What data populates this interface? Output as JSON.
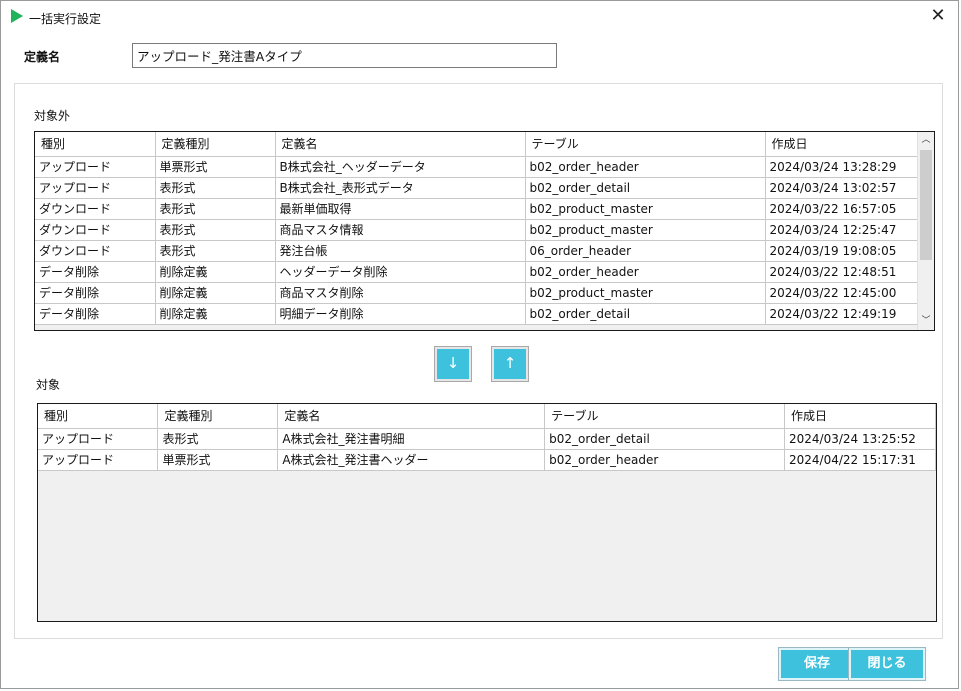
{
  "window": {
    "title": "一括実行設定",
    "close_glyph": "✕"
  },
  "definition": {
    "label": "定義名",
    "value": "アップロード_発注書Aタイプ"
  },
  "excluded": {
    "label": "対象外",
    "columns": [
      "種別",
      "定義種別",
      "定義名",
      "テーブル",
      "作成日"
    ],
    "rows": [
      [
        "アップロード",
        "単票形式",
        "B株式会社_ヘッダーデータ",
        "b02_order_header",
        "2024/03/24 13:28:29"
      ],
      [
        "アップロード",
        "表形式",
        "B株式会社_表形式データ",
        "b02_order_detail",
        "2024/03/24 13:02:57"
      ],
      [
        "ダウンロード",
        "表形式",
        "最新単価取得",
        "b02_product_master",
        "2024/03/22 16:57:05"
      ],
      [
        "ダウンロード",
        "表形式",
        "商品マスタ情報",
        "b02_product_master",
        "2024/03/24 12:25:47"
      ],
      [
        "ダウンロード",
        "表形式",
        "発注台帳",
        "06_order_header",
        "2024/03/19 19:08:05"
      ],
      [
        "データ削除",
        "削除定義",
        "ヘッダーデータ削除",
        "b02_order_header",
        "2024/03/22 12:48:51"
      ],
      [
        "データ削除",
        "削除定義",
        "商品マスタ削除",
        "b02_product_master",
        "2024/03/22 12:45:00"
      ],
      [
        "データ削除",
        "削除定義",
        "明細データ削除",
        "b02_order_detail",
        "2024/03/22 12:49:19"
      ]
    ],
    "scroll_up_glyph": "︿",
    "scroll_down_glyph": "﹀"
  },
  "move_buttons": {
    "down_glyph": "↓",
    "up_glyph": "↑"
  },
  "included": {
    "label": "対象",
    "columns": [
      "種別",
      "定義種別",
      "定義名",
      "テーブル",
      "作成日"
    ],
    "rows": [
      [
        "アップロード",
        "表形式",
        "A株式会社_発注書明細",
        "b02_order_detail",
        "2024/03/24 13:25:52"
      ],
      [
        "アップロード",
        "単票形式",
        "A株式会社_発注書ヘッダー",
        "b02_order_header",
        "2024/04/22 15:17:31"
      ]
    ]
  },
  "actions": {
    "save_label": "保存",
    "close_label": "閉じる"
  },
  "colors": {
    "accent": "#3ec1dc",
    "title_icon": "#1fb35a"
  }
}
